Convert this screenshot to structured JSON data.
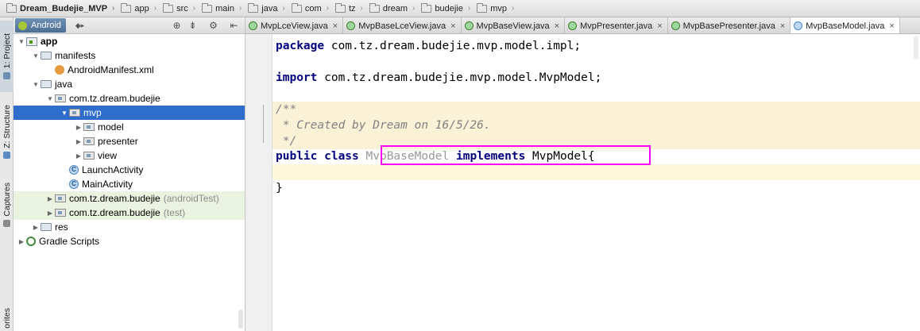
{
  "breadcrumb": [
    "Dream_Budejie_MVP",
    "app",
    "src",
    "main",
    "java",
    "com",
    "tz",
    "dream",
    "budejie",
    "mvp"
  ],
  "tool_strip": {
    "project": "1: Project",
    "structure": "Z: Structure",
    "captures": "Captures",
    "favorites": "orites"
  },
  "project_panel": {
    "view_mode": "Android",
    "toolbar_icons": [
      "target-icon",
      "collapse-icon",
      "gear-icon",
      "hide-icon"
    ]
  },
  "tree": [
    {
      "label": "app",
      "icon": "module",
      "expanded": true,
      "bold": true
    },
    {
      "label": "manifests",
      "icon": "folder",
      "expanded": true
    },
    {
      "label": "AndroidManifest.xml",
      "icon": "xml"
    },
    {
      "label": "java",
      "icon": "folder",
      "expanded": true
    },
    {
      "label": "com.tz.dream.budejie",
      "icon": "package",
      "expanded": true
    },
    {
      "label": "mvp",
      "icon": "package",
      "expanded": true,
      "selected": true
    },
    {
      "label": "model",
      "icon": "package",
      "expanded": false
    },
    {
      "label": "presenter",
      "icon": "package",
      "expanded": false
    },
    {
      "label": "view",
      "icon": "package",
      "expanded": false
    },
    {
      "label": "LaunchActivity",
      "icon": "class"
    },
    {
      "label": "MainActivity",
      "icon": "class"
    },
    {
      "label": "com.tz.dream.budejie",
      "suffix": "(androidTest)",
      "icon": "package",
      "expanded": false,
      "tinted": true
    },
    {
      "label": "com.tz.dream.budejie",
      "suffix": "(test)",
      "icon": "package",
      "expanded": false,
      "tinted": true
    },
    {
      "label": "res",
      "icon": "folder",
      "expanded": false
    },
    {
      "label": "Gradle Scripts",
      "icon": "gradle",
      "expanded": false
    }
  ],
  "tabs": [
    {
      "label": "MvpLceView.java",
      "icon": "interface"
    },
    {
      "label": "MvpBaseLceView.java",
      "icon": "interface"
    },
    {
      "label": "MvpBaseView.java",
      "icon": "interface"
    },
    {
      "label": "MvpPresenter.java",
      "icon": "interface"
    },
    {
      "label": "MvpBasePresenter.java",
      "icon": "interface"
    },
    {
      "label": "MvpBaseModel.java",
      "icon": "class",
      "active": true
    }
  ],
  "code": {
    "package_kw": "package",
    "package_name": " com.tz.dream.budejie.mvp.model.impl;",
    "import_kw": "import",
    "import_name": " com.tz.dream.budejie.mvp.model.MvpModel;",
    "doc_open": "/**",
    "doc_body": " * Created by Dream on 16/5/26.",
    "doc_close": " */",
    "decl_kw": "public class",
    "class_name": "MvpBaseModel",
    "implements_kw": "implements",
    "interface_name": "MvpModel",
    "brace_open": "{",
    "brace_close": "}"
  },
  "colors": {
    "selection": "#2f6dcc",
    "highlight_box": "#ff00ff",
    "keyword": "#000080",
    "comment": "#808080"
  }
}
